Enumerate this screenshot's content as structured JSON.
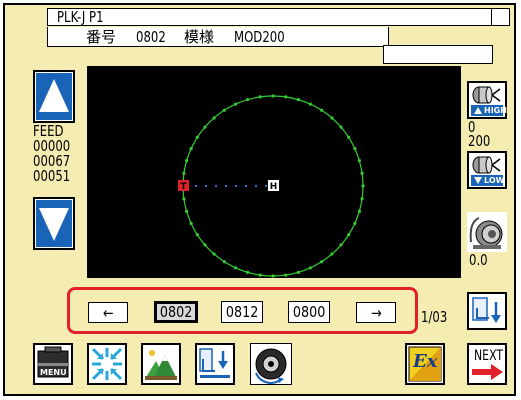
{
  "header": {
    "title": "PLK-J P1",
    "number_label": "番号",
    "number_value": "0802",
    "pattern_label": "模様",
    "pattern_value": "MOD200"
  },
  "left_panel": {
    "feed_label": "FEED",
    "feed_values": [
      "00000",
      "00067",
      "00051"
    ]
  },
  "right_panel": {
    "speed_high_label": "HIGH",
    "speed_low_label": "LOW",
    "speed_values": [
      "0",
      "200"
    ],
    "tension_value": "0.0"
  },
  "canvas": {
    "start_marker": "T",
    "home_marker": "H"
  },
  "pattern_list": {
    "prev_label": "←",
    "next_label": "→",
    "items": [
      "0802",
      "0812",
      "0800"
    ],
    "selected": "0802",
    "page_indicator": "1/03"
  },
  "toolbar": {
    "menu_label": "MENU",
    "next_label": "NEXT",
    "ex_label": "Ex"
  },
  "colors": {
    "background": "#f5ecb2",
    "canvas": "#000000",
    "stitch_green": "#33cc33",
    "highlight_red": "#e0202a",
    "arrow_blue": "#1a64b8"
  }
}
